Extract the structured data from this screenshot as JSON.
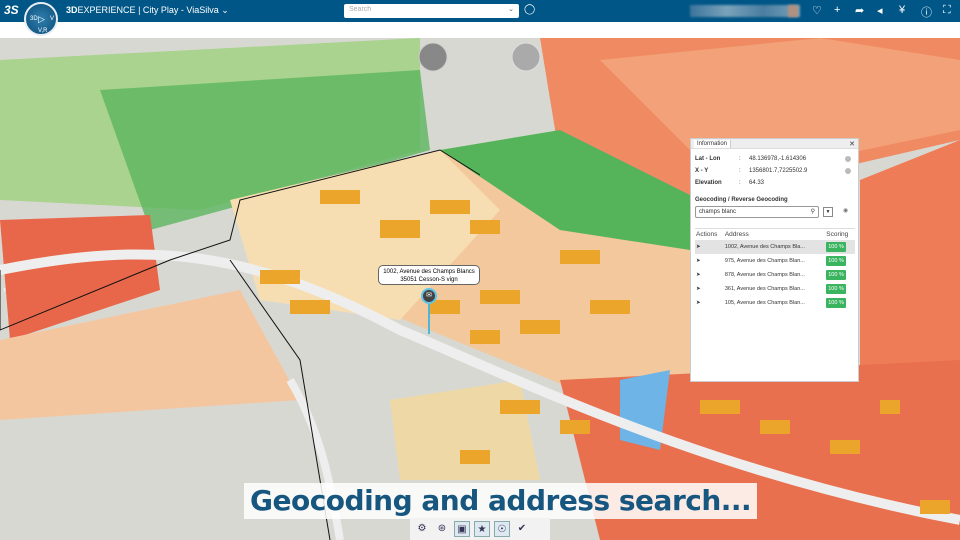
{
  "topbar": {
    "brand": "3D",
    "product": "EXPERIENCE",
    "separator": "|",
    "app": "City Play - ViaSilva",
    "search_placeholder": "Search",
    "compass_labels": {
      "left": "3D",
      "right": "V",
      "bottom": "V,R"
    }
  },
  "info": {
    "tab": "Information",
    "lat_lon_label": "Lat - Lon",
    "lat_lon": "48.136978,-1.614306",
    "xy_label": "X - Y",
    "xy": "1356801.7,7225502.9",
    "elevation_label": "Elevation",
    "elevation": "64.33",
    "colon": ":",
    "geocoding_title": "Geocoding / Reverse Geocoding",
    "query": "champs blanc",
    "columns": [
      "Actions",
      "Address",
      "Scoring"
    ],
    "results": [
      {
        "address": "1002, Avenue des Champs Bla...",
        "score": "100 %"
      },
      {
        "address": "975, Avenue des Champs Blan...",
        "score": "100 %"
      },
      {
        "address": "878, Avenue des Champs Blan...",
        "score": "100 %"
      },
      {
        "address": "361, Avenue des Champs Blan...",
        "score": "100 %"
      },
      {
        "address": "105, Avenue des Champs Blan...",
        "score": "100 %"
      }
    ]
  },
  "callout": {
    "line1": "1002, Avenue des Champs Blancs",
    "line2": "35051 Cesson-S vign"
  },
  "caption": "Geocoding and address search...",
  "colors": {
    "topbar": "#005686",
    "score": "#3bb45f",
    "caption": "#17567f"
  }
}
